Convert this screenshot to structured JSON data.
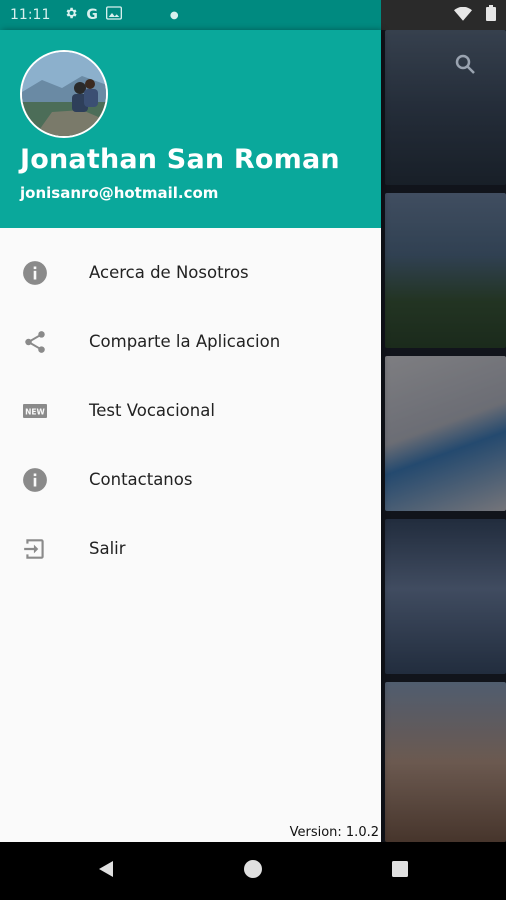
{
  "status_bar": {
    "time": "11:11",
    "icons": [
      "settings-icon",
      "google-icon",
      "photo-icon",
      "notification-dot-icon",
      "wifi-icon",
      "battery-icon"
    ],
    "google_glyph": "G"
  },
  "drawer": {
    "header_color": "#0aa89b",
    "user": {
      "name": "Jonathan San Roman",
      "email": "jonisanro@hotmail.com"
    },
    "items": [
      {
        "icon": "info-icon",
        "label": "Acerca de Nosotros"
      },
      {
        "icon": "share-icon",
        "label": "Comparte la Aplicacion"
      },
      {
        "icon": "new-badge-icon",
        "label": "Test Vocacional",
        "badge_text": "NEW"
      },
      {
        "icon": "info-icon",
        "label": "Contactanos"
      },
      {
        "icon": "exit-icon",
        "label": "Salir"
      }
    ],
    "version": "Version: 1.0.2"
  },
  "nav_bar": {
    "icons": [
      "back-icon",
      "home-icon",
      "recents-icon"
    ]
  }
}
